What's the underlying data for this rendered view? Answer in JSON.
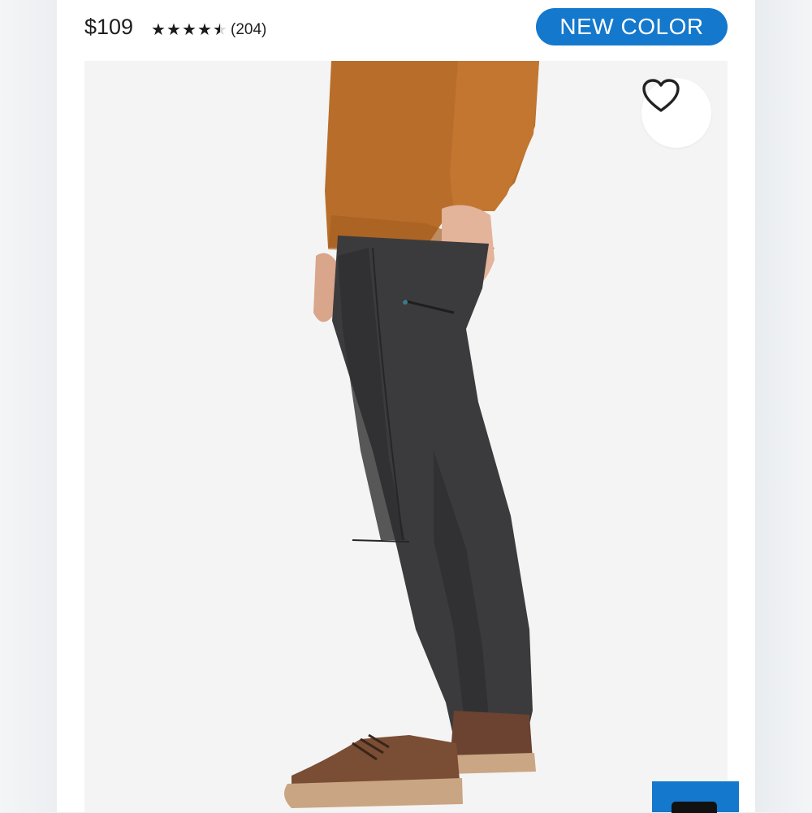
{
  "product": {
    "price": "$109",
    "rating_value": 4.5,
    "rating_max": 5,
    "review_count": "(204)"
  },
  "badge": {
    "label": "NEW COLOR"
  },
  "colors": {
    "accent": "#1478cc",
    "shirt": "#b86e2a",
    "pants": "#3a3a3c",
    "shoes": "#6b4330"
  },
  "icons": {
    "favorite": "heart-outline-icon",
    "star": "star-icon"
  }
}
